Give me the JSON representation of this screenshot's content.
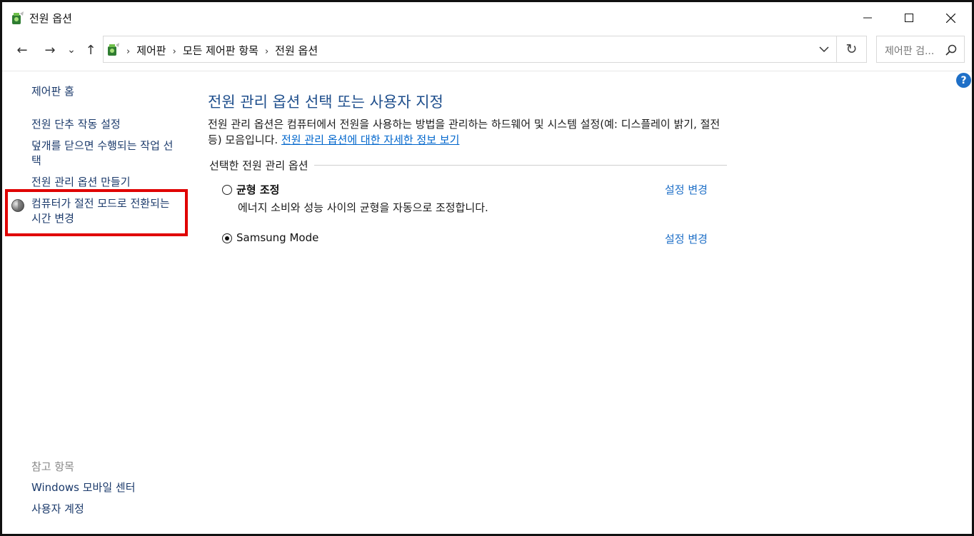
{
  "window": {
    "title": "전원 옵션",
    "minimize_glyph": "—",
    "maximize_glyph": "☐",
    "close_glyph": "✕"
  },
  "nav": {
    "back_glyph": "←",
    "forward_glyph": "→",
    "recent_glyph": "⌄",
    "up_glyph": "↑",
    "refresh_glyph": "↻"
  },
  "address": {
    "crumbs": [
      "제어판",
      "모든 제어판 항목",
      "전원 옵션"
    ],
    "separator": "›"
  },
  "search": {
    "placeholder": "제어판 검..."
  },
  "help_glyph": "?",
  "sidebar": {
    "home": "제어판 홈",
    "items": [
      "전원 단추 작동 설정",
      "덮개를 닫으면 수행되는 작업 선택",
      "전원 관리 옵션 만들기",
      "컴퓨터가 절전 모드로 전환되는 시간 변경"
    ],
    "see_also_label": "참고 항목",
    "see_also": [
      "Windows 모바일 센터",
      "사용자 계정"
    ]
  },
  "main": {
    "heading": "전원 관리 옵션 선택 또는 사용자 지정",
    "description": "전원 관리 옵션은 컴퓨터에서 전원을 사용하는 방법을 관리하는 하드웨어 및 시스템 설정(예: 디스플레이 밝기, 절전 등) 모음입니다.",
    "description_link": "전원 관리 옵션에 대한 자세한 정보 보기",
    "group_label": "선택한 전원 관리 옵션",
    "plans": [
      {
        "name": "균형 조정",
        "description": "에너지 소비와 성능 사이의 균형을 자동으로 조정합니다.",
        "selected": false,
        "change_label": "설정 변경"
      },
      {
        "name": "Samsung Mode",
        "description": "",
        "selected": true,
        "change_label": "설정 변경"
      }
    ]
  },
  "colors": {
    "highlight_box": "#e00000",
    "link": "#1e6fc7",
    "heading": "#1e4e8c"
  },
  "icons": [
    "power-options-icon",
    "control-panel-icon",
    "shield-icon",
    "search-icon",
    "help-icon",
    "chevron-down-icon"
  ]
}
